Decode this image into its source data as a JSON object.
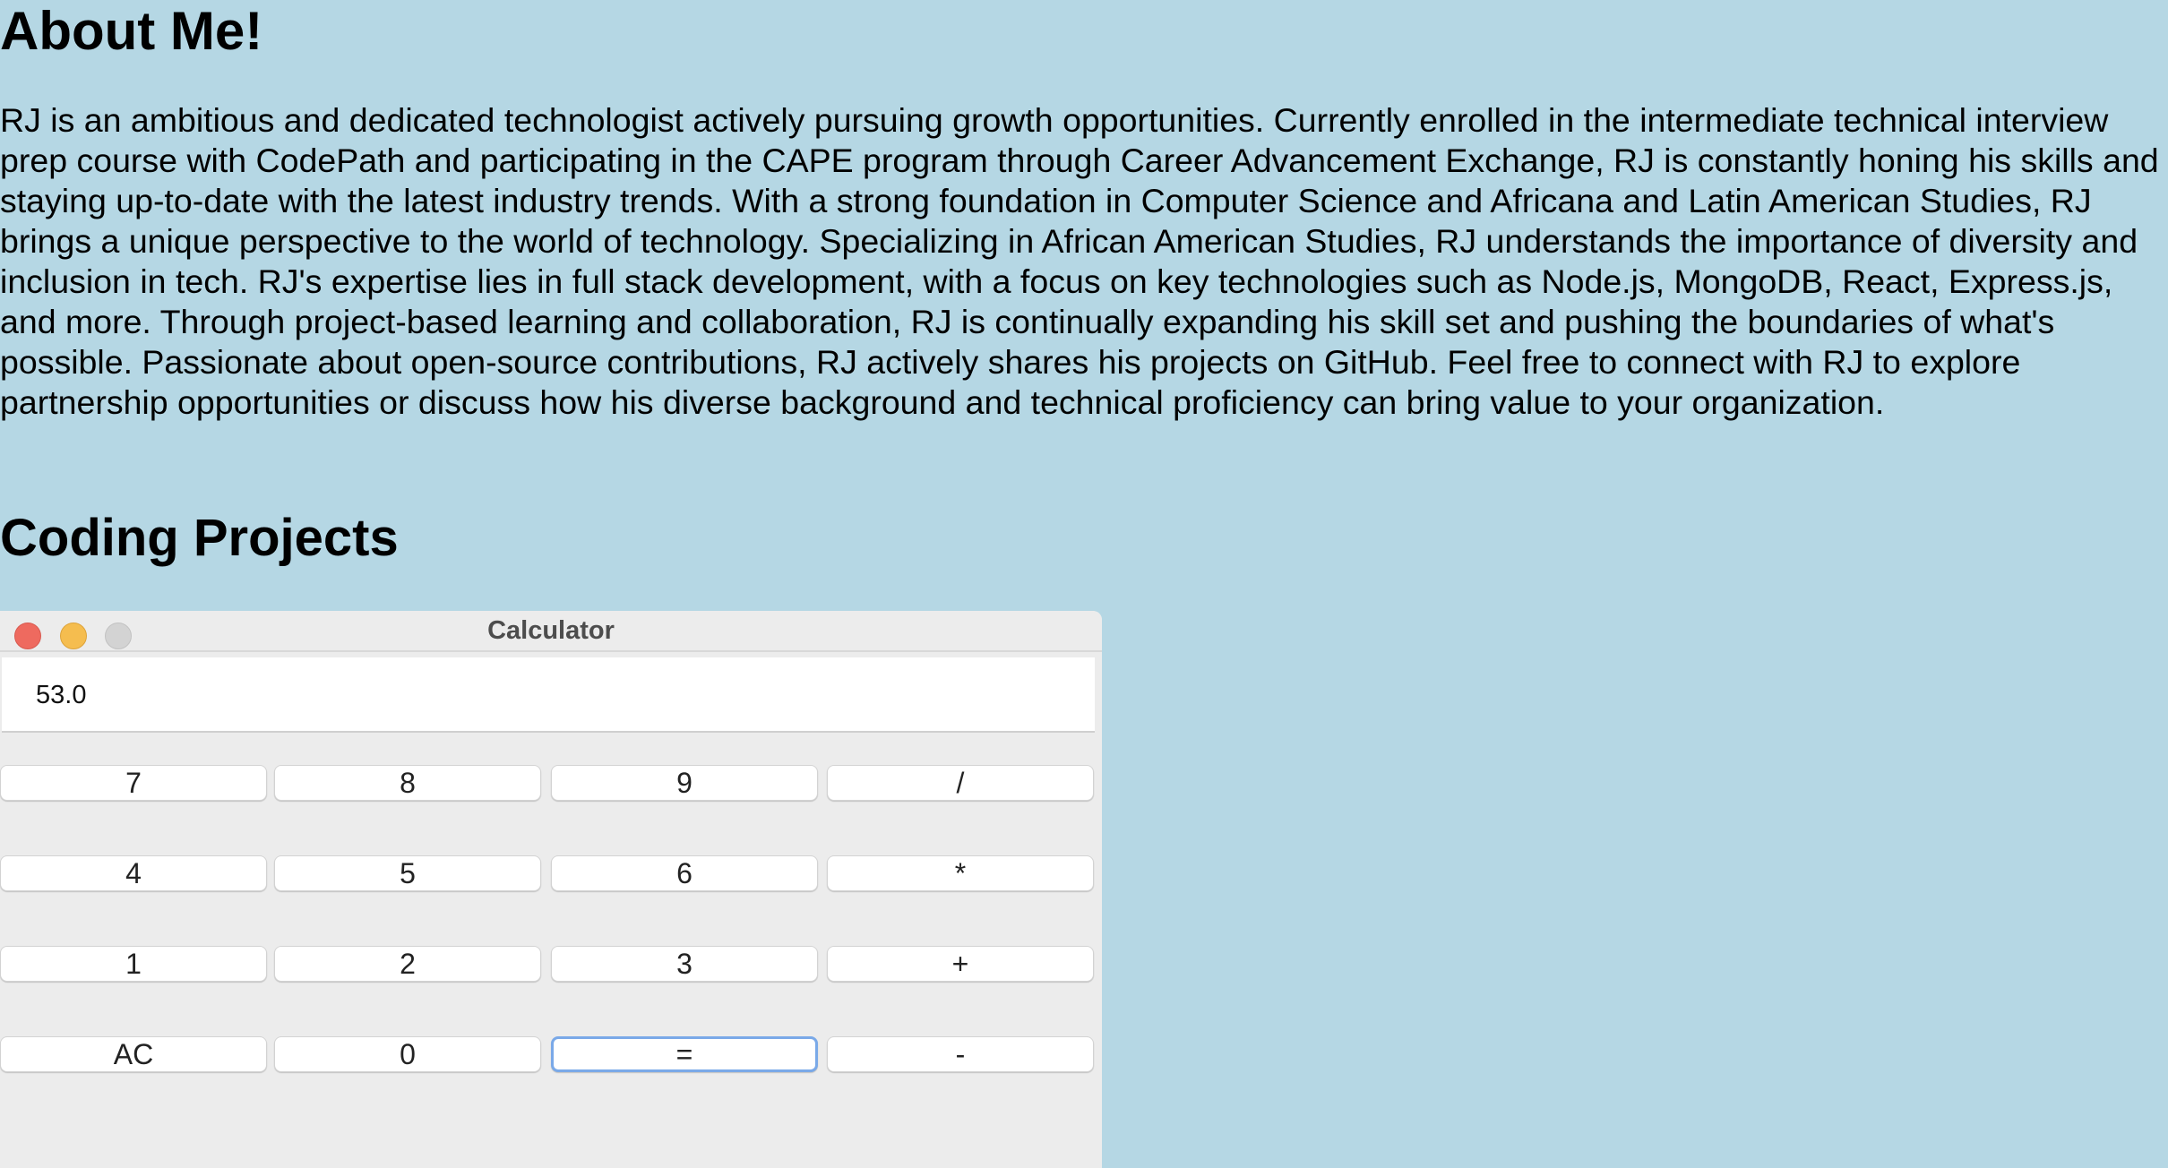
{
  "about": {
    "heading": "About Me!",
    "bio": "RJ is an ambitious and dedicated technologist actively pursuing growth opportunities. Currently enrolled in the intermediate technical interview prep course with CodePath and participating in the CAPE program through Career Advancement Exchange, RJ is constantly honing his skills and staying up-to-date with the latest industry trends. With a strong foundation in Computer Science and Africana and Latin American Studies, RJ brings a unique perspective to the world of technology. Specializing in African American Studies, RJ understands the importance of diversity and inclusion in tech. RJ's expertise lies in full stack development, with a focus on key technologies such as Node.js, MongoDB, React, Express.js, and more. Through project-based learning and collaboration, RJ is continually expanding his skill set and pushing the boundaries of what's possible. Passionate about open-source contributions, RJ actively shares his projects on GitHub. Feel free to connect with RJ to explore partnership opportunities or discuss how his diverse background and technical proficiency can bring value to your organization."
  },
  "projects": {
    "heading": "Coding Projects"
  },
  "calculator": {
    "window_title": "Calculator",
    "display_value": "53.0",
    "focused_key": "=",
    "keys": [
      [
        "7",
        "8",
        "9",
        "/"
      ],
      [
        "4",
        "5",
        "6",
        "*"
      ],
      [
        "1",
        "2",
        "3",
        "+"
      ],
      [
        "AC",
        "0",
        "=",
        "-"
      ]
    ]
  },
  "colors": {
    "page_background": "#b5d7e4",
    "window_background": "#ececec",
    "close_light": "#ee6a5f",
    "minimize_light": "#f5bd4f",
    "zoom_light": "#d3d3d3",
    "focus_ring": "#7aa9e8"
  }
}
